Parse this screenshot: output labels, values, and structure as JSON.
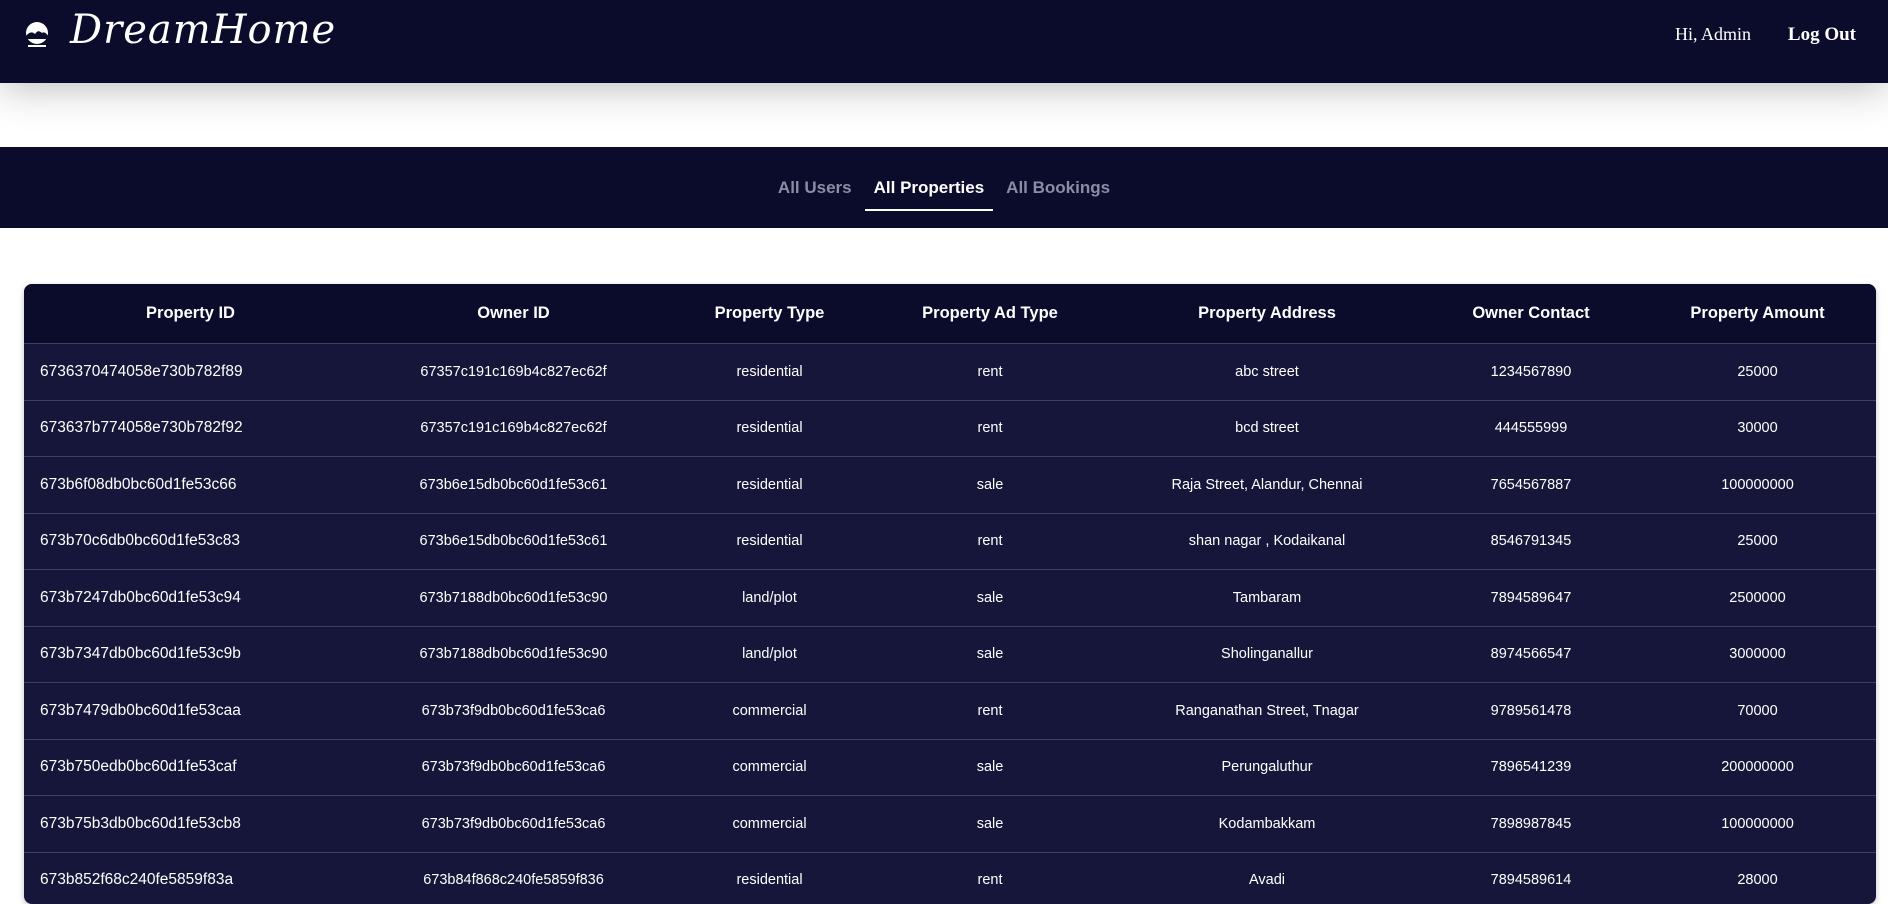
{
  "header": {
    "brand": "DreamHome",
    "greeting": "Hi, Admin",
    "logout_label": "Log Out"
  },
  "tabs": [
    {
      "label": "All Users",
      "active": false
    },
    {
      "label": "All Properties",
      "active": true
    },
    {
      "label": "All Bookings",
      "active": false
    }
  ],
  "table": {
    "columns": [
      "Property ID",
      "Owner ID",
      "Property Type",
      "Property Ad Type",
      "Property Address",
      "Owner Contact",
      "Property Amount"
    ],
    "rows": [
      [
        "6736370474058e730b782f89",
        "67357c191c169b4c827ec62f",
        "residential",
        "rent",
        "abc street",
        "1234567890",
        "25000"
      ],
      [
        "673637b774058e730b782f92",
        "67357c191c169b4c827ec62f",
        "residential",
        "rent",
        "bcd street",
        "444555999",
        "30000"
      ],
      [
        "673b6f08db0bc60d1fe53c66",
        "673b6e15db0bc60d1fe53c61",
        "residential",
        "sale",
        "Raja Street, Alandur, Chennai",
        "7654567887",
        "100000000"
      ],
      [
        "673b70c6db0bc60d1fe53c83",
        "673b6e15db0bc60d1fe53c61",
        "residential",
        "rent",
        "shan nagar , Kodaikanal",
        "8546791345",
        "25000"
      ],
      [
        "673b7247db0bc60d1fe53c94",
        "673b7188db0bc60d1fe53c90",
        "land/plot",
        "sale",
        "Tambaram",
        "7894589647",
        "2500000"
      ],
      [
        "673b7347db0bc60d1fe53c9b",
        "673b7188db0bc60d1fe53c90",
        "land/plot",
        "sale",
        "Sholinganallur",
        "8974566547",
        "3000000"
      ],
      [
        "673b7479db0bc60d1fe53caa",
        "673b73f9db0bc60d1fe53ca6",
        "commercial",
        "rent",
        "Ranganathan Street, Tnagar",
        "9789561478",
        "70000"
      ],
      [
        "673b750edb0bc60d1fe53caf",
        "673b73f9db0bc60d1fe53ca6",
        "commercial",
        "sale",
        "Perungaluthur",
        "7896541239",
        "200000000"
      ],
      [
        "673b75b3db0bc60d1fe53cb8",
        "673b73f9db0bc60d1fe53ca6",
        "commercial",
        "sale",
        "Kodambakkam",
        "7898987845",
        "100000000"
      ],
      [
        "673b852f68c240fe5859f83a",
        "673b84f868c240fe5859f836",
        "residential",
        "rent",
        "Avadi",
        "7894589614",
        "28000"
      ]
    ]
  }
}
